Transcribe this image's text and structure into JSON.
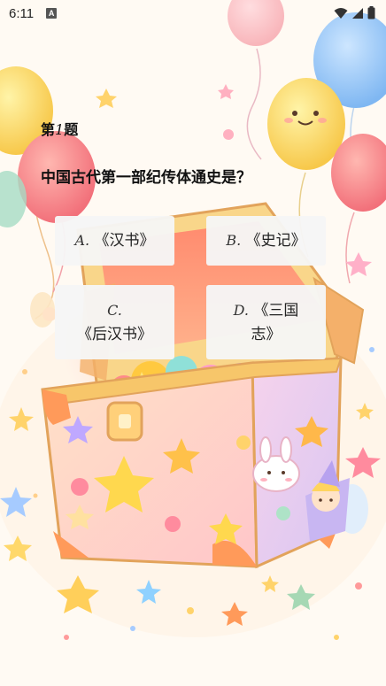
{
  "status_bar": {
    "time": "6:11",
    "badge": "A"
  },
  "quiz": {
    "number_prefix": "第",
    "number": "1",
    "number_suffix": "题",
    "question": "中国古代第一部纪传体通史是？",
    "options": [
      {
        "letter": "A.",
        "text": "《汉书》"
      },
      {
        "letter": "B.",
        "text": "《史记》"
      },
      {
        "letter": "C.",
        "text": "《后汉书》"
      },
      {
        "letter": "D.",
        "text": "《三国志》"
      }
    ]
  },
  "colors": {
    "background": "#fffaf3",
    "option_bg": "#f6f6f6",
    "text": "#111111"
  }
}
